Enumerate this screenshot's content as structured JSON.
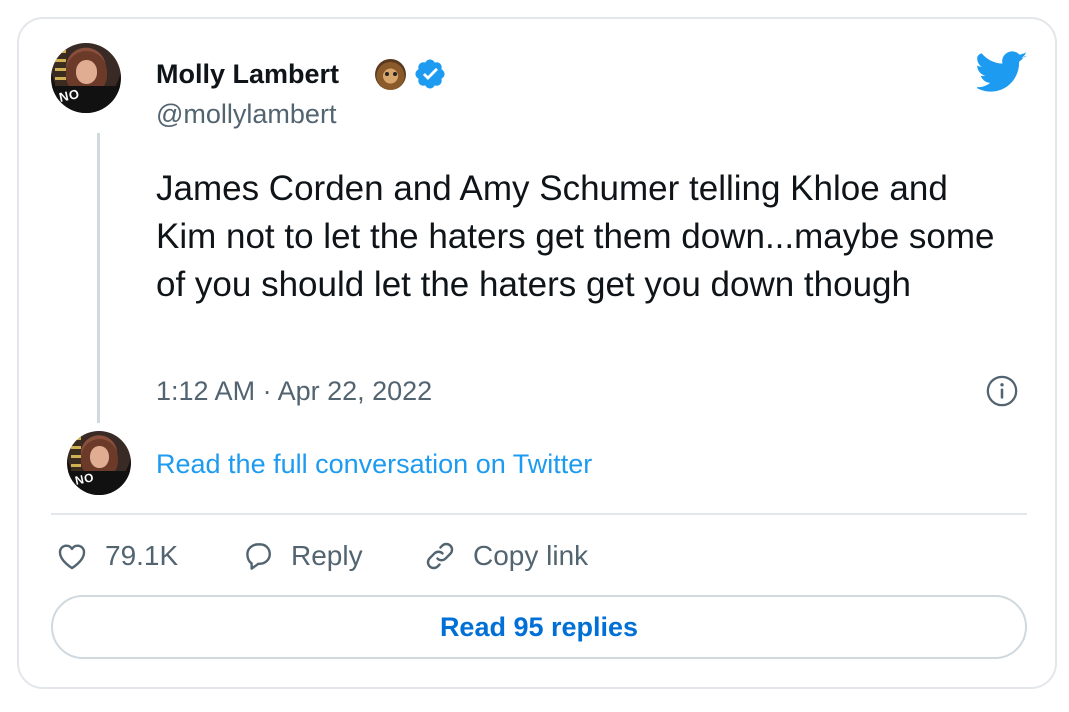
{
  "author": {
    "name": "Molly Lambert",
    "handle": "@mollylambert",
    "avatar_shirt_text": "NO",
    "name_emoji": "hedgehog-emoji",
    "verified_badge": "verified-badge-icon"
  },
  "tweet": {
    "text": "James Corden and Amy Schumer telling Khloe and Kim not to let the haters get them down...maybe some of you should let the haters get you down though",
    "timestamp": "1:12 AM · Apr 22, 2022"
  },
  "conversation_link": {
    "label": "Read the full conversation on Twitter",
    "avatar_shirt_text": "NO"
  },
  "actions": {
    "like_count": "79.1K",
    "reply_label": "Reply",
    "copy_link_label": "Copy link"
  },
  "replies_button": {
    "label": "Read 95 replies"
  },
  "colors": {
    "twitter_blue": "#1d9bf0",
    "link_blue": "#006fd6",
    "secondary_text": "#536471",
    "primary_text": "#0f1419",
    "border": "#e3e6ea"
  },
  "icons": {
    "brand": "twitter-bird-icon",
    "info": "info-icon",
    "like": "heart-icon",
    "reply": "speech-bubble-icon",
    "copy_link": "link-icon"
  }
}
